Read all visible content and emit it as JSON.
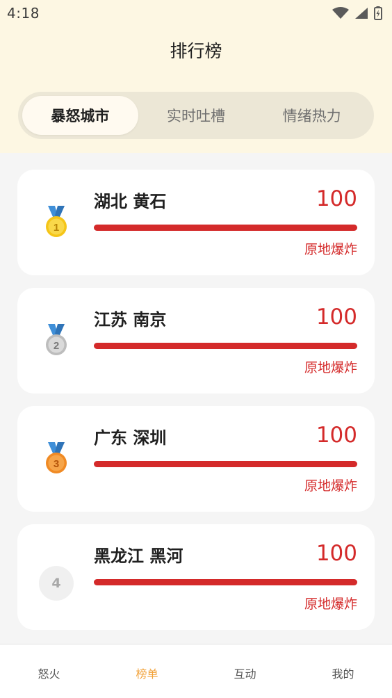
{
  "status_bar": {
    "time": "4:18"
  },
  "page": {
    "title": "排行榜"
  },
  "tabs": [
    {
      "label": "暴怒城市",
      "active": true
    },
    {
      "label": "实时吐槽",
      "active": false
    },
    {
      "label": "情绪热力",
      "active": false
    }
  ],
  "rankings": [
    {
      "rank": "1",
      "medal": "gold-medal-icon",
      "city": "湖北 黄石",
      "score": "100",
      "level": 1.0,
      "status": "原地爆炸"
    },
    {
      "rank": "2",
      "medal": "silver-medal-icon",
      "city": "江苏 南京",
      "score": "100",
      "level": 1.0,
      "status": "原地爆炸"
    },
    {
      "rank": "3",
      "medal": "bronze-medal-icon",
      "city": "广东 深圳",
      "score": "100",
      "level": 1.0,
      "status": "原地爆炸"
    },
    {
      "rank": "4",
      "medal": "",
      "city": "黑龙江 黑河",
      "score": "100",
      "level": 1.0,
      "status": "原地爆炸"
    }
  ],
  "bottom_nav": [
    {
      "label": "怒火",
      "active": false
    },
    {
      "label": "榜单",
      "active": true
    },
    {
      "label": "互动",
      "active": false
    },
    {
      "label": "我的",
      "active": false
    }
  ],
  "colors": {
    "header_bg": "#fdf7e3",
    "accent_red": "#d42a2a",
    "nav_active": "#f2a23a",
    "gold": "#f5c518",
    "silver": "#c9c9c9",
    "bronze": "#f08a24",
    "ribbon_blue": "#3f8fd8"
  }
}
